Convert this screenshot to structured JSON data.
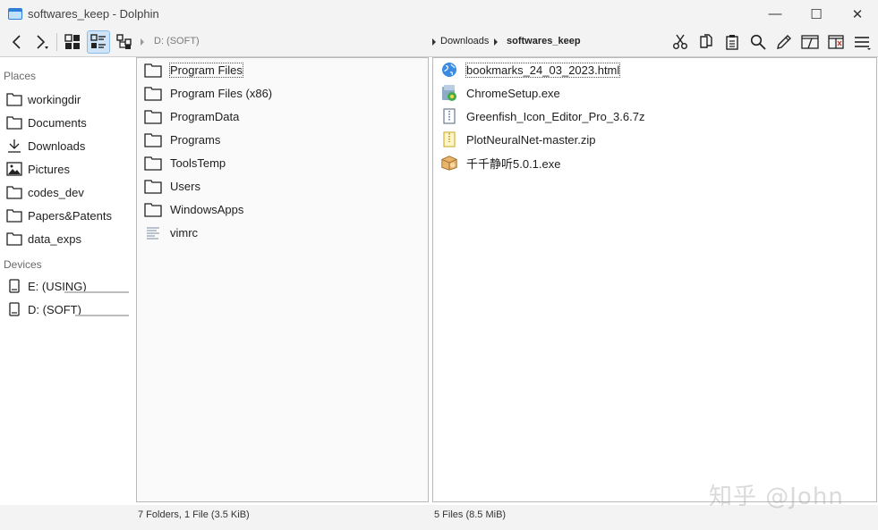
{
  "window": {
    "title": "softwares_keep - Dolphin",
    "minimize_glyph": "—",
    "maximize_glyph": "☐",
    "close_glyph": "✕"
  },
  "toolbar": {
    "location_root": "D: (SOFT)",
    "breadcrumb": [
      "Downloads",
      "softwares_keep"
    ]
  },
  "places": {
    "places_header": "Places",
    "items": [
      {
        "label": "workingdir",
        "icon": "folder-icon"
      },
      {
        "label": "Documents",
        "icon": "folder-icon"
      },
      {
        "label": "Downloads",
        "icon": "download-icon"
      },
      {
        "label": "Pictures",
        "icon": "image-icon"
      },
      {
        "label": "codes_dev",
        "icon": "folder-icon"
      },
      {
        "label": "Papers&Patents",
        "icon": "folder-icon"
      },
      {
        "label": "data_exps",
        "icon": "folder-icon"
      }
    ],
    "devices_header": "Devices",
    "devices": [
      {
        "label": "E: (USING)",
        "icon": "drive-icon"
      },
      {
        "label": "D: (SOFT)",
        "icon": "drive-icon"
      }
    ]
  },
  "left_pane": {
    "entries": [
      {
        "name": "Program Files",
        "type": "folder"
      },
      {
        "name": "Program Files (x86)",
        "type": "folder"
      },
      {
        "name": "ProgramData",
        "type": "folder"
      },
      {
        "name": "Programs",
        "type": "folder"
      },
      {
        "name": "ToolsTemp",
        "type": "folder"
      },
      {
        "name": "Users",
        "type": "folder"
      },
      {
        "name": "WindowsApps",
        "type": "folder"
      },
      {
        "name": "vimrc",
        "type": "text-file"
      }
    ],
    "status": "7 Folders, 1 File (3.5 KiB)"
  },
  "right_pane": {
    "entries": [
      {
        "name": "bookmarks_24_03_2023.html",
        "type": "html-file"
      },
      {
        "name": "ChromeSetup.exe",
        "type": "installer-exe"
      },
      {
        "name": "Greenfish_Icon_Editor_Pro_3.6.7z",
        "type": "archive-7z"
      },
      {
        "name": "PlotNeuralNet-master.zip",
        "type": "archive-zip"
      },
      {
        "name": "千千静听5.0.1.exe",
        "type": "app-exe"
      }
    ],
    "status": "5 Files (8.5 MiB)"
  },
  "watermark": "知乎 @John"
}
